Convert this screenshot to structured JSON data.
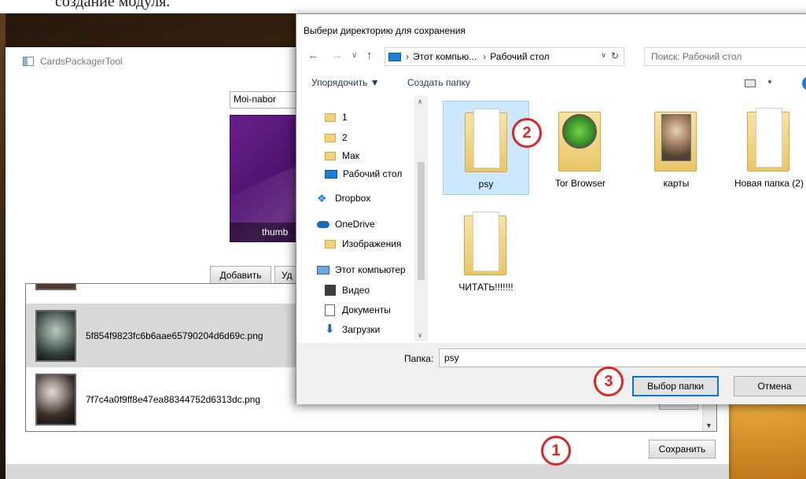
{
  "top_text": "создание модуля.",
  "app": {
    "title": "CardsPackagerTool",
    "name_value": "Moi-nabor",
    "thumb_label": "thumb",
    "add_button": "Добавить",
    "delete_button_partial": "Уд",
    "save_button": "Сохранить",
    "files": [
      "5f854f9823fc6b6aae65790204d6d69c.png",
      "7f7c4a0f9ff8e47ea88344752d6313dc.png"
    ]
  },
  "dialog": {
    "title": "Выбери директорию для сохранения",
    "breadcrumbs": [
      "Этот компью...",
      "Рабочий стол"
    ],
    "search_placeholder": "Поиск: Рабочий стол",
    "toolbar": {
      "organize": "Упорядочить",
      "new_folder": "Создать папку"
    },
    "nav_items": [
      {
        "label": "1",
        "icon": "folder-icon"
      },
      {
        "label": "2",
        "icon": "folder-icon"
      },
      {
        "label": "Мак",
        "icon": "folder-icon"
      },
      {
        "label": "Рабочий стол",
        "icon": "desktop-icon"
      },
      {
        "label": "Dropbox",
        "icon": "dropbox-icon"
      },
      {
        "label": "OneDrive",
        "icon": "onedrive-icon"
      },
      {
        "label": "Изображения",
        "icon": "folder-icon"
      },
      {
        "label": "Этот компьютер",
        "icon": "computer-icon"
      },
      {
        "label": "Видео",
        "icon": "video-icon"
      },
      {
        "label": "Документы",
        "icon": "documents-icon"
      },
      {
        "label": "Загрузки",
        "icon": "downloads-icon"
      }
    ],
    "tiles": [
      {
        "label": "psy",
        "selected": true
      },
      {
        "label": "Tor Browser"
      },
      {
        "label": "карты"
      },
      {
        "label": "Новая папка (2)"
      },
      {
        "label": "ЧИТАТЬ!!!!!!!"
      }
    ],
    "folder_label": "Папка:",
    "folder_value": "psy",
    "select_button": "Выбор папки",
    "cancel_button": "Отмена"
  },
  "markers": [
    "1",
    "2",
    "3"
  ],
  "colors": {
    "marker": "#e02424",
    "selection": "#cce8ff",
    "accent": "#0078d7"
  }
}
